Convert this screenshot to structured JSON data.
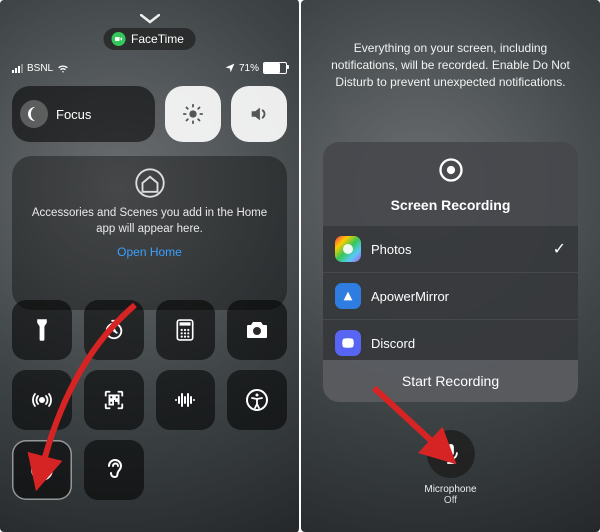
{
  "left": {
    "facetime_label": "FaceTime",
    "carrier": "BSNL",
    "battery_percent": "71%",
    "focus_label": "Focus",
    "home_text": "Accessories and Scenes you add in the Home app will appear here.",
    "open_home": "Open Home"
  },
  "right": {
    "hint_text": "Everything on your screen, including notifications, will be recorded. Enable Do Not Disturb to prevent unexpected notifications.",
    "sheet_title": "Screen Recording",
    "options": {
      "photos": "Photos",
      "apower": "ApowerMirror",
      "discord": "Discord"
    },
    "start_label": "Start Recording",
    "mic_label": "Microphone",
    "mic_state": "Off"
  }
}
